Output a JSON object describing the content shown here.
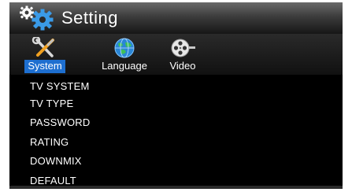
{
  "header": {
    "title": "Setting",
    "icon": "gears-icon"
  },
  "tabs": [
    {
      "label": "System",
      "icon": "tools-icon",
      "active": true
    },
    {
      "label": "Language",
      "icon": "globe-icon",
      "active": false
    },
    {
      "label": "Video",
      "icon": "film-reel-icon",
      "active": false
    }
  ],
  "menu": {
    "items": [
      "TV SYSTEM",
      "TV TYPE",
      "PASSWORD",
      "RATING",
      "DOWNMIX",
      "DEFAULT"
    ]
  },
  "colors": {
    "panel_background": "#000000",
    "active_tab_highlight": "#1e6fd0",
    "gear_color": "#3a9be8",
    "text": "#ffffff"
  }
}
